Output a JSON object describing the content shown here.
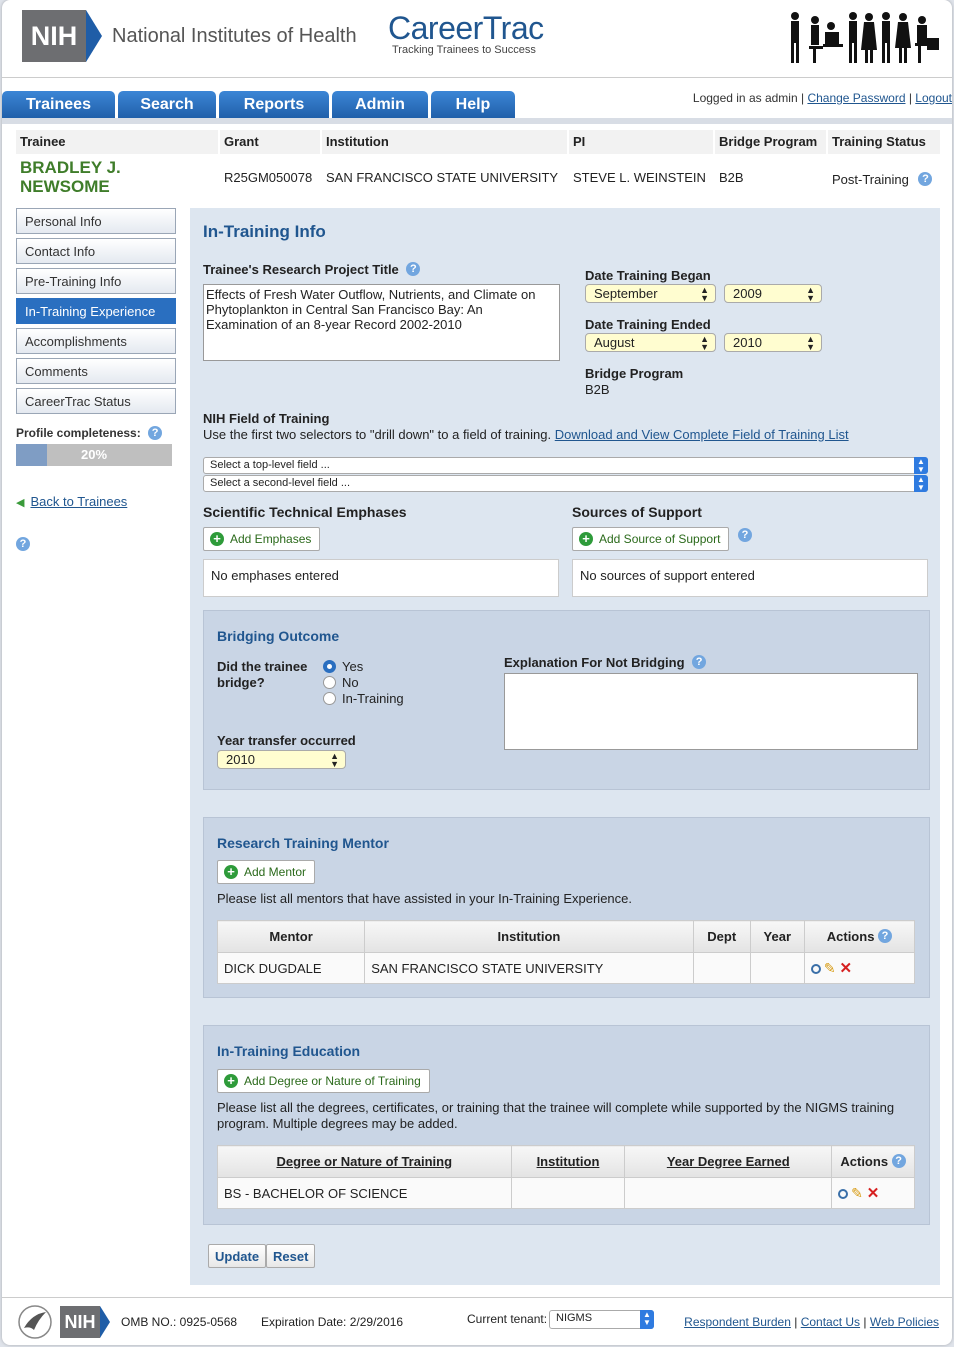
{
  "header": {
    "nih_abbrev": "NIH",
    "nih_name": "National Institutes of Health",
    "app_name": "CareerTrac",
    "app_tagline": "Tracking Trainees to Success"
  },
  "nav": {
    "tabs": [
      "Trainees",
      "Search",
      "Reports",
      "Admin",
      "Help"
    ],
    "logged_in": "Logged in as admin |",
    "change_password": "Change Password",
    "logout": "Logout"
  },
  "trainee": {
    "headers": {
      "trainee": "Trainee",
      "grant": "Grant",
      "institution": "Institution",
      "pi": "PI",
      "bridge": "Bridge Program",
      "status": "Training Status"
    },
    "name_line1": "BRADLEY J.",
    "name_line2": "NEWSOME",
    "grant": "R25GM050078",
    "institution": "SAN FRANCISCO STATE UNIVERSITY",
    "pi": "STEVE L. WEINSTEIN",
    "bridge": "B2B",
    "status": "Post-Training"
  },
  "sidebar": {
    "items": [
      "Personal Info",
      "Contact Info",
      "Pre-Training Info",
      "In-Training Experience",
      "Accomplishments",
      "Comments",
      "CareerTrac Status"
    ],
    "active_index": 3,
    "completeness_label": "Profile completeness:",
    "completeness_value": "20%",
    "completeness_fraction": 0.2,
    "back_label": "Back to Trainees"
  },
  "form": {
    "section_title": "In-Training Info",
    "project_title_label": "Trainee's Research Project Title",
    "project_title_value": "Effects of Fresh Water Outflow, Nutrients, and Climate on Phytoplankton in Central San Francisco Bay: An Examination of an 8-year Record 2002-2010",
    "began_label": "Date Training Began",
    "began_month": "September",
    "began_year": "2009",
    "ended_label": "Date Training Ended",
    "ended_month": "August",
    "ended_year": "2010",
    "bridge_label": "Bridge Program",
    "bridge_value": "B2B",
    "field_label": "NIH Field of Training",
    "field_help": "Use the first two selectors to \"drill down\" to a field of training.",
    "field_link": "Download and View Complete Field of Training List",
    "top_level_placeholder": "Select a top-level field ...",
    "second_level_placeholder": "Select a second-level field ...",
    "emphases_label": "Scientific Technical Emphases",
    "add_emphases": "Add Emphases",
    "no_emphases": "No emphases entered",
    "support_label": "Sources of Support",
    "add_support": "Add Source of Support",
    "no_support": "No sources of support entered"
  },
  "bridging": {
    "title": "Bridging Outcome",
    "question": "Did the trainee bridge?",
    "options": [
      "Yes",
      "No",
      "In-Training"
    ],
    "selected": "Yes",
    "explanation_label": "Explanation For Not Bridging",
    "year_label": "Year transfer occurred",
    "year_value": "2010"
  },
  "mentor": {
    "title": "Research Training Mentor",
    "add_label": "Add Mentor",
    "help_text": "Please list all mentors that have assisted in your In-Training Experience.",
    "columns": [
      "Mentor",
      "Institution",
      "Dept",
      "Year",
      "Actions"
    ],
    "rows": [
      {
        "mentor": "DICK DUGDALE",
        "institution": "SAN FRANCISCO STATE UNIVERSITY",
        "dept": "",
        "year": ""
      }
    ]
  },
  "education": {
    "title": "In-Training Education",
    "add_label": "Add Degree or Nature of Training",
    "help_text": "Please list all the degrees, certificates, or training that the trainee will complete while supported by the NIGMS training program. Multiple degrees may be added.",
    "columns": [
      "Degree or Nature of Training",
      "Institution",
      "Year Degree Earned",
      "Actions"
    ],
    "rows": [
      {
        "degree": "BS - BACHELOR OF SCIENCE",
        "institution": "",
        "year": ""
      }
    ]
  },
  "actions": {
    "update": "Update",
    "reset": "Reset"
  },
  "footer": {
    "nih_abbrev": "NIH",
    "omb": "OMB NO.: 0925-0568",
    "expiration": "Expiration Date: 2/29/2016",
    "tenant_label": "Current tenant:",
    "tenant_value": "NIGMS",
    "links": [
      "Respondent Burden",
      "Contact Us",
      "Web Policies"
    ]
  },
  "colors": {
    "brand_blue": "#20568f",
    "nav_blue": "#2c73c4",
    "name_green": "#3f7d2a",
    "select_yellow": "#fffdd0"
  }
}
